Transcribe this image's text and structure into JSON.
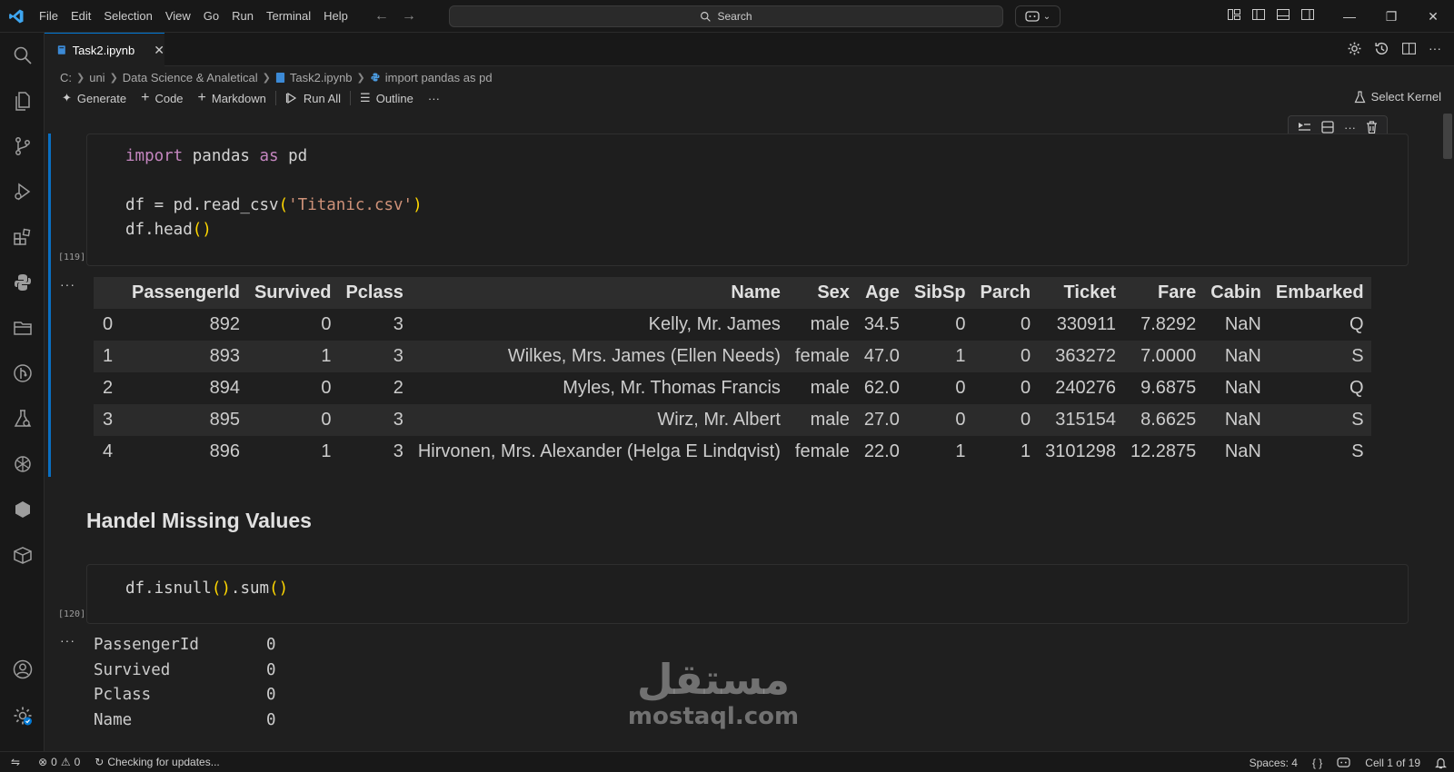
{
  "menu": [
    "File",
    "Edit",
    "Selection",
    "View",
    "Go",
    "Run",
    "Terminal",
    "Help"
  ],
  "search": {
    "label": "Search"
  },
  "tab": {
    "label": "Task2.ipynb"
  },
  "breadcrumbs": [
    "C:",
    "uni",
    "Data Science & Analetical",
    "Task2.ipynb",
    "import pandas as pd"
  ],
  "toolbar": {
    "generate": "Generate",
    "code": "Code",
    "markdown": "Markdown",
    "run_all": "Run All",
    "outline": "Outline",
    "more": "···",
    "select_kernel": "Select Kernel"
  },
  "cells": {
    "cell1_count": "[119]",
    "cell2_count": "[120]",
    "output_dots": "···"
  },
  "code1": {
    "l1_kw1": "import",
    "l1_mid": " pandas ",
    "l1_kw2": "as",
    "l1_end": " pd",
    "l3_a": "df = pd.read_csv",
    "l3_p1": "(",
    "l3_str": "'Titanic.csv'",
    "l3_p2": ")",
    "l4_a": "df.head",
    "l4_p": "()"
  },
  "code2": {
    "a": "df.isnull",
    "p1": "()",
    "b": ".sum",
    "p2": "()"
  },
  "dataframe": {
    "columns": [
      "",
      "PassengerId",
      "Survived",
      "Pclass",
      "Name",
      "Sex",
      "Age",
      "SibSp",
      "Parch",
      "Ticket",
      "Fare",
      "Cabin",
      "Embarked"
    ],
    "rows": [
      [
        "0",
        "892",
        "0",
        "3",
        "Kelly, Mr. James",
        "male",
        "34.5",
        "0",
        "0",
        "330911",
        "7.8292",
        "NaN",
        "Q"
      ],
      [
        "1",
        "893",
        "1",
        "3",
        "Wilkes, Mrs. James (Ellen Needs)",
        "female",
        "47.0",
        "1",
        "0",
        "363272",
        "7.0000",
        "NaN",
        "S"
      ],
      [
        "2",
        "894",
        "0",
        "2",
        "Myles, Mr. Thomas Francis",
        "male",
        "62.0",
        "0",
        "0",
        "240276",
        "9.6875",
        "NaN",
        "Q"
      ],
      [
        "3",
        "895",
        "0",
        "3",
        "Wirz, Mr. Albert",
        "male",
        "27.0",
        "0",
        "0",
        "315154",
        "8.6625",
        "NaN",
        "S"
      ],
      [
        "4",
        "896",
        "1",
        "3",
        "Hirvonen, Mrs. Alexander (Helga E Lindqvist)",
        "female",
        "22.0",
        "1",
        "1",
        "3101298",
        "12.2875",
        "NaN",
        "S"
      ]
    ]
  },
  "markdown_heading": "Handel Missing Values",
  "isnull_output": [
    [
      "PassengerId",
      "0"
    ],
    [
      "Survived",
      "0"
    ],
    [
      "Pclass",
      "0"
    ],
    [
      "Name",
      "0"
    ]
  ],
  "watermark": {
    "arabic": "مستقل",
    "latin": "mostaql.com"
  },
  "statusbar": {
    "errors": "0",
    "warnings": "0",
    "checking": "Checking for updates...",
    "spaces": "Spaces: 4",
    "braces": "{ }",
    "cell_position": "Cell 1 of 19"
  },
  "colors": {
    "accent": "#0078d4",
    "keyword": "#c586c0",
    "string": "#ce9178",
    "bracket": "#ffd700"
  }
}
